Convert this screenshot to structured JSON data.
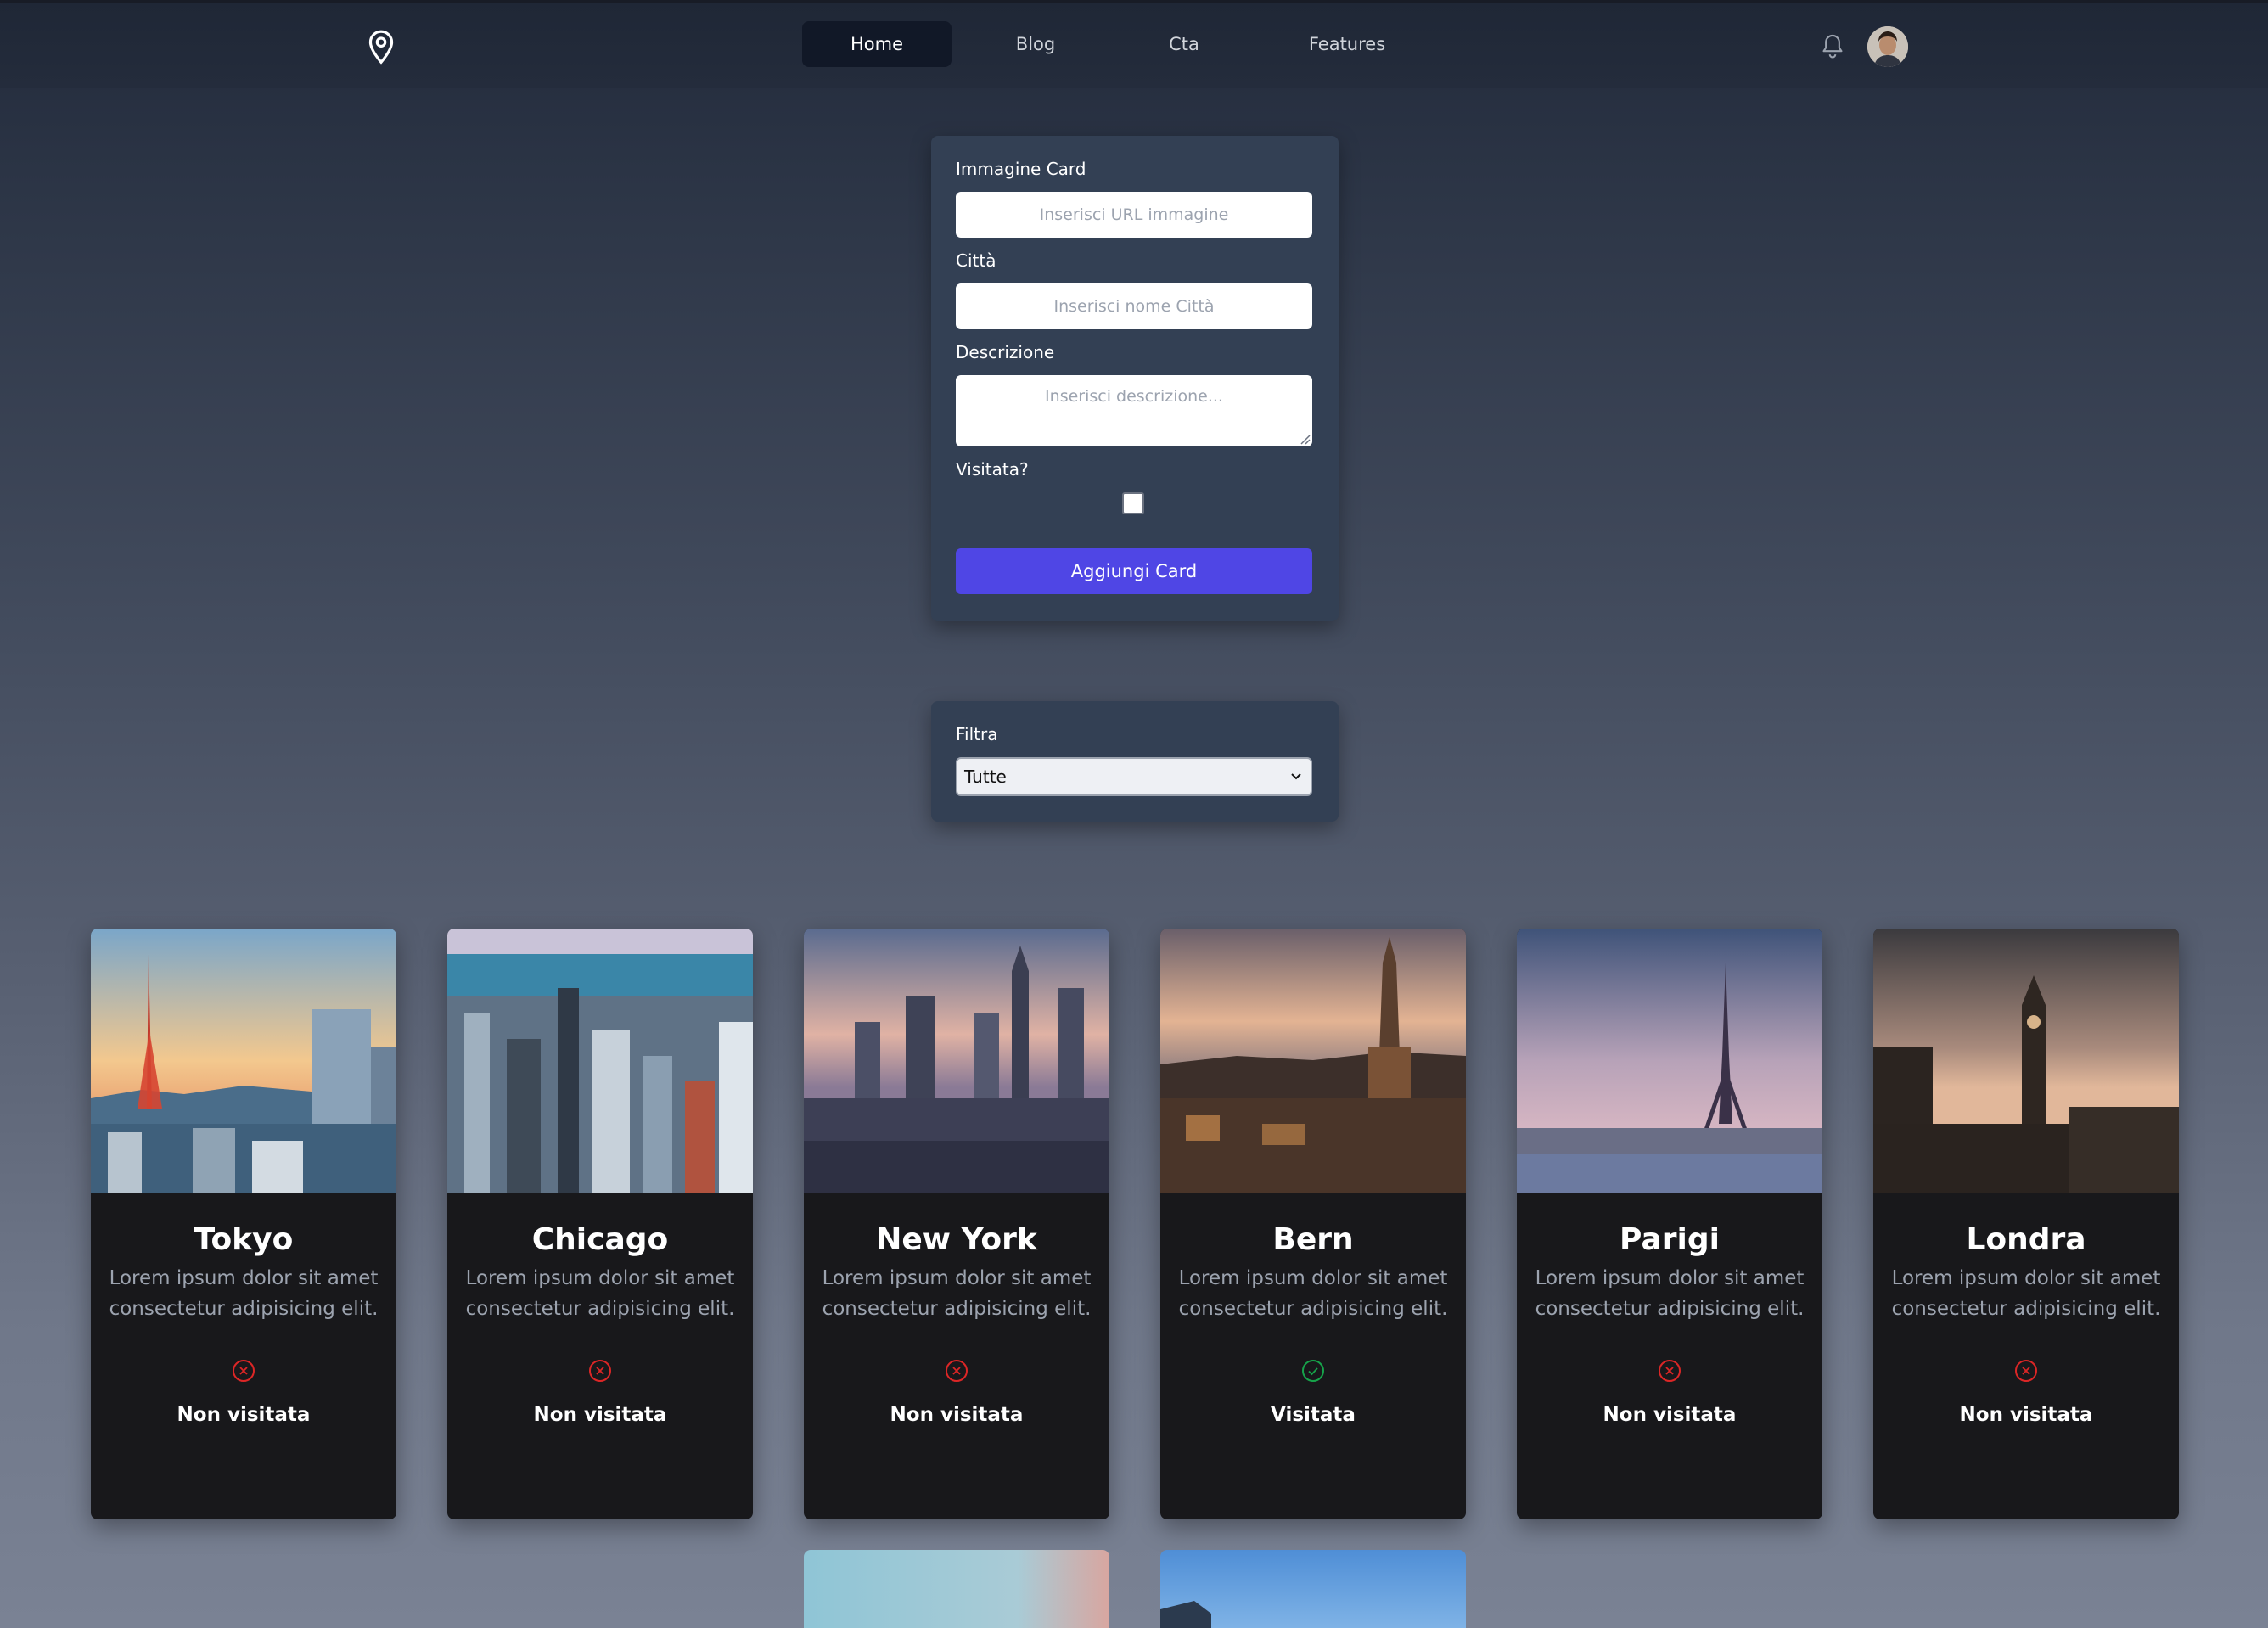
{
  "nav": {
    "logo_icon": "map-pin-icon",
    "items": [
      {
        "label": "Home",
        "active": true
      },
      {
        "label": "Blog",
        "active": false
      },
      {
        "label": "Cta",
        "active": false
      },
      {
        "label": "Features",
        "active": false
      }
    ],
    "bell_icon": "bell-icon",
    "avatar_icon": "user-avatar"
  },
  "form": {
    "image_label": "Immagine Card",
    "image_placeholder": "Inserisci URL immagine",
    "city_label": "Città",
    "city_placeholder": "Inserisci nome Città",
    "description_label": "Descrizione",
    "description_placeholder": "Inserisci descrizione...",
    "visited_label": "Visitata?",
    "visited_checked": false,
    "submit_label": "Aggiungi Card",
    "accent_color": "#4f46e5"
  },
  "filter": {
    "label": "Filtra",
    "selected": "Tutte"
  },
  "cards": [
    {
      "city": "Tokyo",
      "description": "Lorem ipsum dolor sit amet consectetur adipisicing elit.",
      "visited": false,
      "status": "Non visitata",
      "status_icon": "x-circle-icon"
    },
    {
      "city": "Chicago",
      "description": "Lorem ipsum dolor sit amet consectetur adipisicing elit.",
      "visited": false,
      "status": "Non visitata",
      "status_icon": "x-circle-icon"
    },
    {
      "city": "New York",
      "description": "Lorem ipsum dolor sit amet consectetur adipisicing elit.",
      "visited": false,
      "status": "Non visitata",
      "status_icon": "x-circle-icon"
    },
    {
      "city": "Bern",
      "description": "Lorem ipsum dolor sit amet consectetur adipisicing elit.",
      "visited": true,
      "status": "Visitata",
      "status_icon": "check-circle-icon"
    },
    {
      "city": "Parigi",
      "description": "Lorem ipsum dolor sit amet consectetur adipisicing elit.",
      "visited": false,
      "status": "Non visitata",
      "status_icon": "x-circle-icon"
    },
    {
      "city": "Londra",
      "description": "Lorem ipsum dolor sit amet consectetur adipisicing elit.",
      "visited": false,
      "status": "Non visitata",
      "status_icon": "x-circle-icon"
    }
  ],
  "colors": {
    "not_visited": "#dc2626",
    "visited": "#16a34a"
  }
}
